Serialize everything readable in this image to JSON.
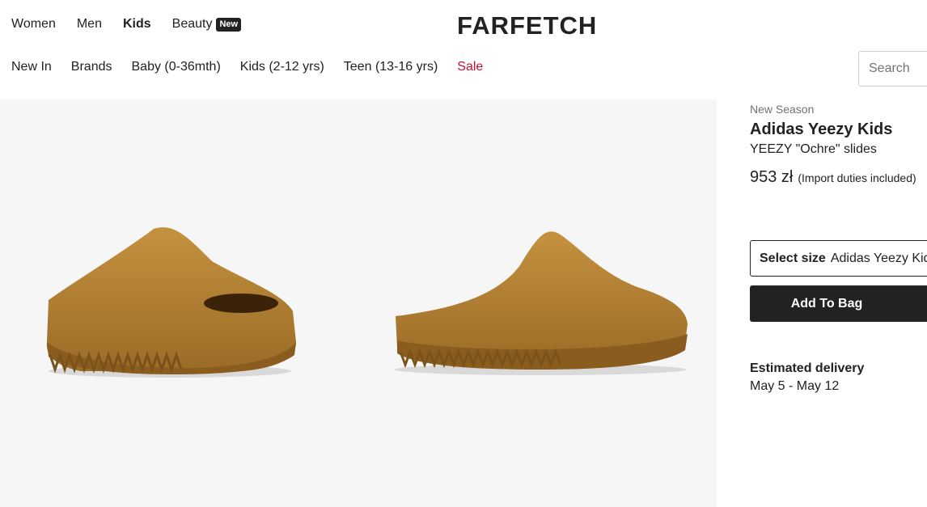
{
  "header": {
    "top_nav": [
      "Women",
      "Men",
      "Kids",
      "Beauty"
    ],
    "active_item": "Kids",
    "new_badge": "New",
    "logo": "FARFETCH"
  },
  "sub_nav": {
    "items": [
      "New In",
      "Brands",
      "Baby (0-36mth)",
      "Kids (2-12 yrs)",
      "Teen (13-16 yrs)"
    ],
    "sale": "Sale",
    "sale_color": "#c8102e"
  },
  "search": {
    "placeholder": "Search"
  },
  "gallery": {
    "images": [
      "ochre-slide-angle-view",
      "ochre-slide-side-view"
    ],
    "product_color": "#b6863a"
  },
  "product": {
    "label": "New Season",
    "brand": "Adidas Yeezy Kids",
    "description": "YEEZY \"Ochre\" slides",
    "price": "953 zł",
    "duties": "(Import duties included)"
  },
  "size_select": {
    "label": "Select size",
    "value": "Adidas Yeezy Kids"
  },
  "add_to_bag": "Add To Bag",
  "delivery": {
    "title": "Estimated delivery",
    "range": "May 5 - May 12"
  }
}
